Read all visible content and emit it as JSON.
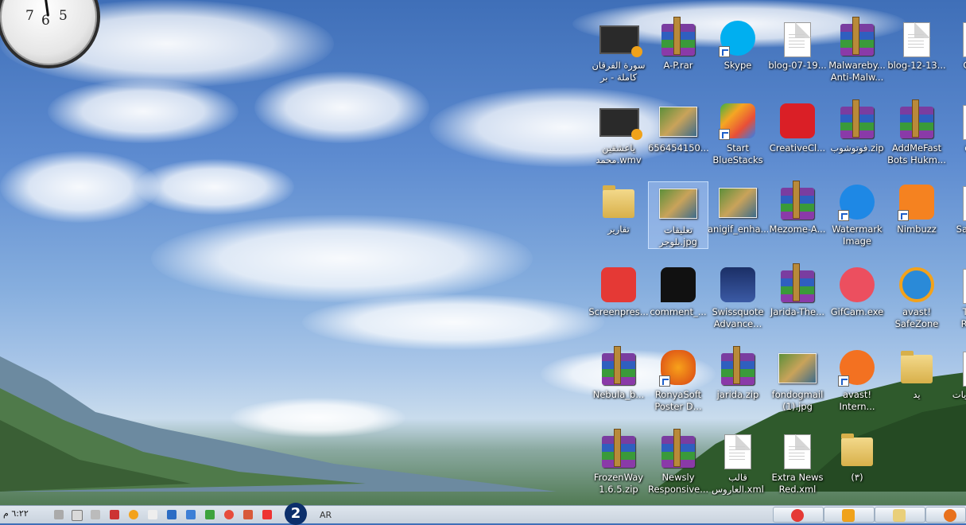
{
  "clock": {
    "numerals": [
      "7",
      "6",
      "5"
    ]
  },
  "desktop": {
    "icons": [
      {
        "label": "سورة الفرقان كاملة - بر",
        "glyph": "video"
      },
      {
        "label": "A-P.rar",
        "glyph": "rar"
      },
      {
        "label": "Skype",
        "glyph": "skype-icon"
      },
      {
        "label": "blog-07-19...",
        "glyph": "doc"
      },
      {
        "label": "Malwareby... Anti-Malw...",
        "glyph": "rar"
      },
      {
        "label": "blog-12-13...",
        "glyph": "doc"
      },
      {
        "label": "Cha...",
        "glyph": "doc"
      },
      {
        "label": "ياعشقين محمد.wmv",
        "glyph": "video"
      },
      {
        "label": "656454150...",
        "glyph": "photo"
      },
      {
        "label": "Start BlueStacks",
        "glyph": "bluestacks-icon"
      },
      {
        "label": "CreativeCl...",
        "glyph": "creative-cloud-icon"
      },
      {
        "label": "فوتوشوب.zip",
        "glyph": "rar"
      },
      {
        "label": "AddMeFast Bots Hukm...",
        "glyph": "rar"
      },
      {
        "label": "dm...",
        "glyph": "doc"
      },
      {
        "label": "تقارير",
        "glyph": "folder"
      },
      {
        "label": "تعليقات بلوجر.jpg",
        "glyph": "photo"
      },
      {
        "label": "anigif_enha...",
        "glyph": "photo"
      },
      {
        "label": "Mezome-A...",
        "glyph": "rar"
      },
      {
        "label": "Watermark Image",
        "glyph": "watermark-icon"
      },
      {
        "label": "Nimbuzz",
        "glyph": "nimbuzz-icon"
      },
      {
        "label": "Sa... Ki...",
        "glyph": "doc"
      },
      {
        "label": "Screenpres...",
        "glyph": "screenpresso-icon"
      },
      {
        "label": "comment_...",
        "glyph": "comment-icon"
      },
      {
        "label": "Swissquote Advance...",
        "glyph": "swissquote-icon"
      },
      {
        "label": "Jarida-The...",
        "glyph": "rar"
      },
      {
        "label": "GifCam.exe",
        "glyph": "gifcam-icon"
      },
      {
        "label": "avast! SafeZone",
        "glyph": "avast-safezone-icon"
      },
      {
        "label": "Tota... Reco...",
        "glyph": "doc"
      },
      {
        "label": "Nebula_b...",
        "glyph": "rar"
      },
      {
        "label": "RonyaSoft Poster D...",
        "glyph": "dragon-icon"
      },
      {
        "label": "jarida.zip",
        "glyph": "rar"
      },
      {
        "label": "fondogmail (1).jpg",
        "glyph": "photo"
      },
      {
        "label": "avast! Intern...",
        "glyph": "avast-icon"
      },
      {
        "label": "يد",
        "glyph": "folder"
      },
      {
        "label": "معزيات.xml",
        "glyph": "doc"
      },
      {
        "label": "FrozenWay 1.6.5.zip",
        "glyph": "rar"
      },
      {
        "label": "Newsly Responsive...",
        "glyph": "rar"
      },
      {
        "label": "قالب العاروس.xml",
        "glyph": "doc"
      },
      {
        "label": "Extra News Red.xml",
        "glyph": "doc"
      },
      {
        "label": "(٣)",
        "glyph": "folder"
      }
    ]
  },
  "taskbar": {
    "time": "٦:٢٢ م",
    "language": "AR",
    "quick_launch": "2"
  }
}
